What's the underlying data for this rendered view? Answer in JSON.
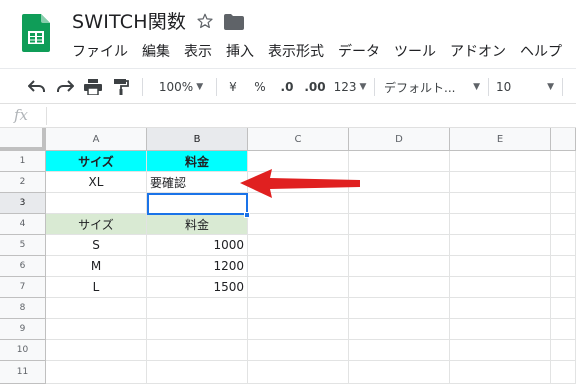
{
  "doc": {
    "title": "SWITCH関数"
  },
  "menu": [
    "ファイル",
    "編集",
    "表示",
    "挿入",
    "表示形式",
    "データ",
    "ツール",
    "アドオン",
    "ヘルプ"
  ],
  "toolbar": {
    "zoom": "100%",
    "currency": "¥",
    "percent": "%",
    "dec_decrease": ".0",
    "dec_increase": ".00",
    "more_formats": "123",
    "font": "デフォルト...",
    "font_size": "10"
  },
  "formula": {
    "label": "fx",
    "value": ""
  },
  "grid": {
    "columns": [
      "A",
      "B",
      "C",
      "D",
      "E"
    ],
    "rows": [
      "1",
      "2",
      "3",
      "4",
      "5",
      "6",
      "7",
      "8",
      "9",
      "10",
      "11"
    ],
    "cells": {
      "A1": "サイズ",
      "B1": "料金",
      "A2": "XL",
      "B2": "要確認",
      "A4": "サイズ",
      "B4": "料金",
      "A5": "S",
      "B5": "1000",
      "A6": "M",
      "B6": "1200",
      "A7": "L",
      "B7": "1500"
    },
    "selected_cell": "B3"
  },
  "colors": {
    "header_fill": "#00ffff",
    "table_header_fill": "#d9ead3",
    "selection": "#1a73e8",
    "arrow": "#e02020",
    "logo": "#0f9d58"
  }
}
